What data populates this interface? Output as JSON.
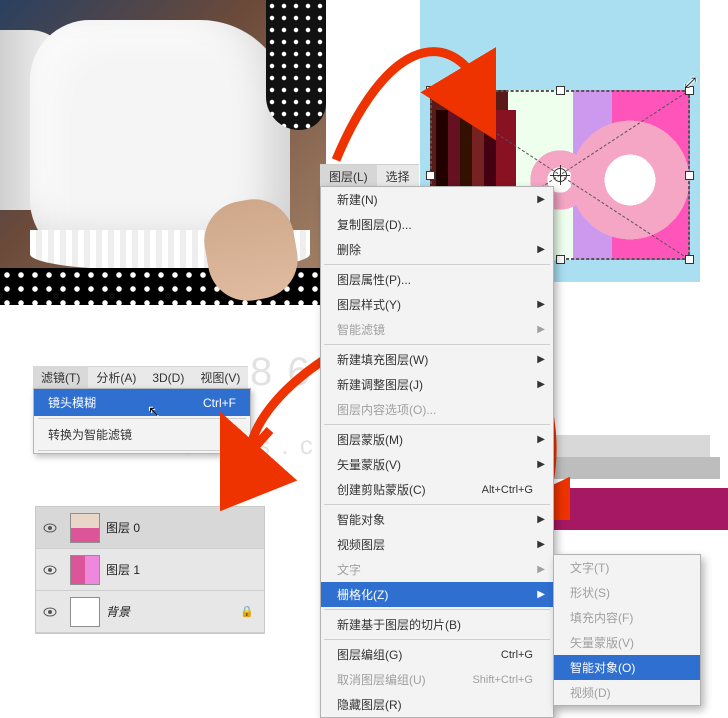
{
  "watermark": "8 6 p s . c o m",
  "filterMenubar": {
    "filter": "滤镜(T)",
    "analysis": "分析(A)",
    "threeD": "3D(D)",
    "view": "视图(V)"
  },
  "filterDropdown": {
    "lensBlur": "镜头模糊",
    "lensBlurShortcut": "Ctrl+F",
    "convertSmart": "转换为智能滤镜"
  },
  "mainMenubar": {
    "layer": "图层(L)",
    "select": "选择"
  },
  "layerMenu": {
    "new": "新建(N)",
    "duplicate": "复制图层(D)...",
    "delete": "删除",
    "properties": "图层属性(P)...",
    "style": "图层样式(Y)",
    "smartFilter": "智能滤镜",
    "newFill": "新建填充图层(W)",
    "newAdjust": "新建调整图层(J)",
    "contentOptions": "图层内容选项(O)...",
    "layerMask": "图层蒙版(M)",
    "vectorMask": "矢量蒙版(V)",
    "clippingMask": "创建剪贴蒙版(C)",
    "clippingMaskShortcut": "Alt+Ctrl+G",
    "smartObjects": "智能对象",
    "videoLayers": "视频图层",
    "type": "文字",
    "rasterize": "栅格化(Z)",
    "newSlice": "新建基于图层的切片(B)",
    "group": "图层编组(G)",
    "groupShortcut": "Ctrl+G",
    "ungroup": "取消图层编组(U)",
    "ungroupShortcut": "Shift+Ctrl+G",
    "hide": "隐藏图层(R)"
  },
  "subMenu": {
    "type": "文字(T)",
    "shape": "形状(S)",
    "fill": "填充内容(F)",
    "vectorMask": "矢量蒙版(V)",
    "smartObject": "智能对象(O)",
    "video": "视频(D)"
  },
  "layersPanel": {
    "layer0": "图层 0",
    "layer1": "图层 1",
    "background": "背景"
  }
}
